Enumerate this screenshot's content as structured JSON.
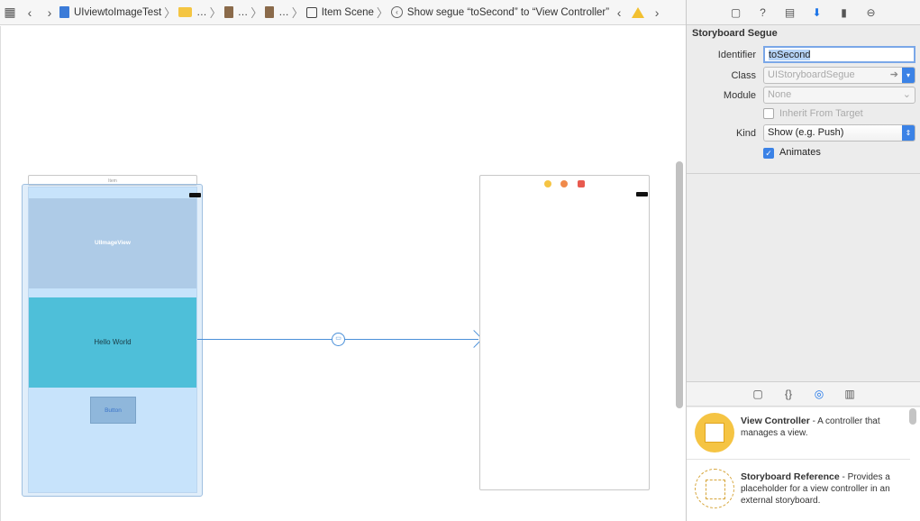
{
  "jumpbar": {
    "project": "UIviewtoImageTest",
    "ellipsis": "…",
    "scene": "Item Scene",
    "segue": "Show segue “toSecond” to “View Controller”"
  },
  "canvas": {
    "vc1_top_label": "Item",
    "image_view_label": "UIImageView",
    "hello_label": "Hello World",
    "button_label": "Button"
  },
  "inspector": {
    "section_title": "Storyboard Segue",
    "identifier_label": "Identifier",
    "identifier_value": "toSecond",
    "class_label": "Class",
    "class_placeholder": "UIStoryboardSegue",
    "module_label": "Module",
    "module_placeholder": "None",
    "inherit_label": "Inherit From Target",
    "kind_label": "Kind",
    "kind_value": "Show (e.g. Push)",
    "animates_label": "Animates"
  },
  "library": {
    "items": [
      {
        "title": "View Controller",
        "desc": " - A controller that manages a view."
      },
      {
        "title": "Storyboard Reference",
        "desc": " - Provides a placeholder for a view controller in an external storyboard."
      }
    ]
  },
  "colors": {
    "accent": "#3b82e6",
    "segue": "#4a90d9",
    "hello_bg": "#4ebfd9",
    "vc_icon": "#f5c443"
  }
}
